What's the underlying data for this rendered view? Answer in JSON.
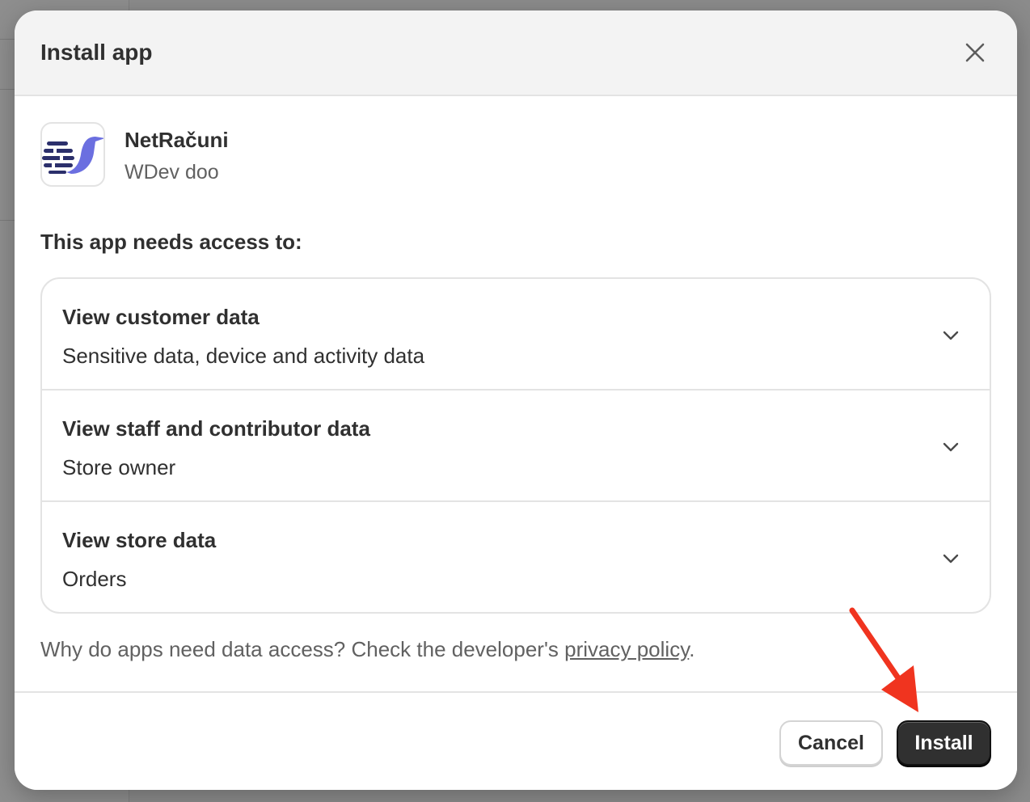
{
  "modal": {
    "title": "Install app",
    "close_icon": "close-icon"
  },
  "app": {
    "name": "NetRačuni",
    "developer": "WDev doo",
    "logo_colors": [
      "#2b2f6b",
      "#6b6fe0"
    ]
  },
  "access": {
    "heading": "This app needs access to:",
    "items": [
      {
        "title": "View customer data",
        "description": "Sensitive data, device and activity data"
      },
      {
        "title": "View staff and contributor data",
        "description": "Store owner"
      },
      {
        "title": "View store data",
        "description": "Orders"
      }
    ]
  },
  "footnote": {
    "text": "Why do apps need data access? Check the developer's ",
    "link": "privacy policy",
    "end": "."
  },
  "footer": {
    "cancel_label": "Cancel",
    "install_label": "Install"
  },
  "annotation": {
    "arrow_color": "#f0341f"
  }
}
